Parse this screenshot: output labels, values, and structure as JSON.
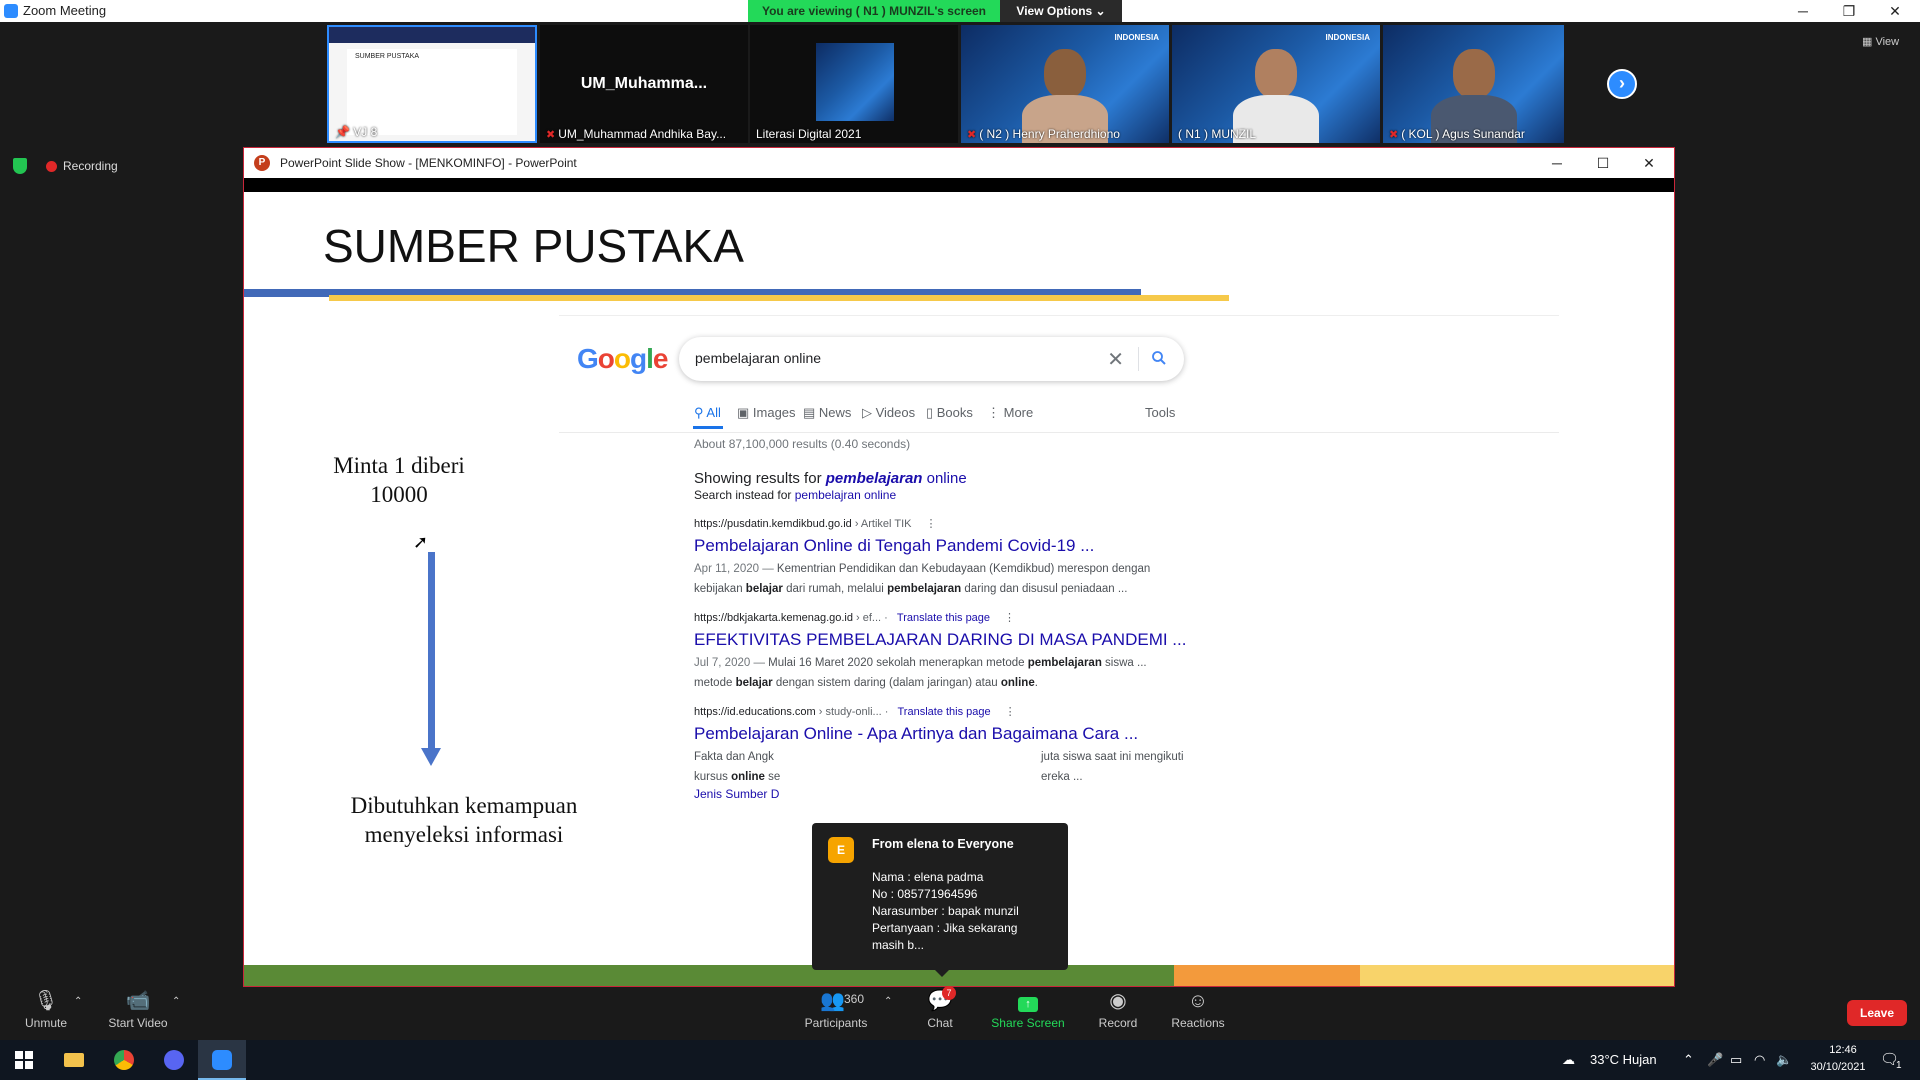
{
  "window": {
    "title": "Zoom Meeting"
  },
  "banner": {
    "viewing": "You are viewing ( N1 ) MUNZIL's screen",
    "view_options": "View Options ⌄"
  },
  "strip": {
    "tiles": [
      {
        "name": "VJ 8"
      },
      {
        "name": "UM_Muhammad Andhika Bay...",
        "big": "UM_Muhamma..."
      },
      {
        "name": "Literasi Digital 2021"
      },
      {
        "name": "( N2 ) Henry Praherdhiono"
      },
      {
        "name": "( N1 ) MUNZIL"
      },
      {
        "name": "( KOL ) Agus Sunandar"
      }
    ],
    "indonesia_label": "INDONESIA",
    "view_label": "View"
  },
  "recording": {
    "label": "Recording"
  },
  "ppt": {
    "title": "PowerPoint Slide Show - [MENKOMINFO] - PowerPoint",
    "slide": {
      "title": "SUMBER PUSTAKA",
      "left_top": "Minta 1 diberi 10000",
      "left_bottom": "Dibutuhkan kemampuan menyeleksi informasi"
    }
  },
  "google": {
    "logo": [
      "G",
      "o",
      "o",
      "g",
      "l",
      "e"
    ],
    "logo_colors": [
      "#4285f4",
      "#ea4335",
      "#fbbc05",
      "#4285f4",
      "#34a853",
      "#ea4335"
    ],
    "query": "pembelajaran online",
    "tabs": [
      "All",
      "Images",
      "News",
      "Videos",
      "Books",
      "More"
    ],
    "tools": "Tools",
    "stats": "About 87,100,000 results (0.40 seconds)",
    "showing_prefix": "Showing results for ",
    "showing_kw": "pembelajaran",
    "showing_kw2": " online",
    "instead_prefix": "Search instead for ",
    "instead_link": "pembelajran online",
    "results": [
      {
        "domain": "https://pusdatin.kemdikbud.go.id",
        "crumb": " › Artikel TIK",
        "translate": "",
        "title": "Pembelajaran Online di Tengah Pandemi Covid-19 ...",
        "date": "Apr 11, 2020 — ",
        "snippet1": "Kementrian Pendidikan dan Kebudayaan (Kemdikbud) merespon dengan",
        "snippet2": "kebijakan belajar dari rumah, melalui pembelajaran daring dan disusul peniadaan ..."
      },
      {
        "domain": "https://bdkjakarta.kemenag.go.id",
        "crumb": " › ef...",
        "translate": "Translate this page",
        "title": "EFEKTIVITAS PEMBELAJARAN DARING DI MASA PANDEMI ...",
        "date": "Jul 7, 2020 — ",
        "snippet1": "Mulai 16 Maret 2020 sekolah menerapkan metode pembelajaran siswa ...",
        "snippet2": "metode belajar dengan sistem daring (dalam jaringan) atau online."
      },
      {
        "domain": "https://id.educations.com",
        "crumb": " › study-onli...",
        "translate": "Translate this page",
        "title": "Pembelajaran Online - Apa Artinya dan Bagaimana Cara ...",
        "date": "",
        "snippet1": "Fakta dan Angk",
        "snippet1_tail": "juta siswa saat ini mengikuti",
        "snippet2": "kursus online se",
        "snippet2_tail": "ereka ...",
        "more": "Jenis Sumber D"
      }
    ]
  },
  "chat_popup": {
    "avatar": "E",
    "from": "From elena to Everyone",
    "lines": [
      "Nama : elena padma",
      "No : 085771964596",
      "Narasumber : bapak munzil",
      "Pertanyaan : Jika sekarang",
      "masih b..."
    ]
  },
  "toolbar": {
    "unmute": "Unmute",
    "start_video": "Start Video",
    "participants": "Participants",
    "participants_count": "360",
    "chat": "Chat",
    "chat_badge": "7",
    "share": "Share Screen",
    "record": "Record",
    "reactions": "Reactions",
    "leave": "Leave"
  },
  "taskbar": {
    "weather": "33°C  Hujan",
    "time": "12:46",
    "date": "30/10/2021",
    "notif": "1"
  }
}
